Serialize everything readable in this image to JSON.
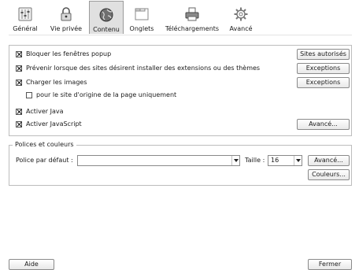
{
  "toolbar": {
    "items": [
      {
        "label": "Général",
        "icon": "general-settings-icon"
      },
      {
        "label": "Vie privée",
        "icon": "lock-icon"
      },
      {
        "label": "Contenu",
        "icon": "globe-icon"
      },
      {
        "label": "Onglets",
        "icon": "tabs-window-icon"
      },
      {
        "label": "Téléchargements",
        "icon": "printer-download-icon"
      },
      {
        "label": "Avancé",
        "icon": "gear-icon"
      }
    ],
    "selected": "Contenu"
  },
  "content": {
    "options": [
      {
        "label": "Bloquer les fenêtres popup",
        "checked": true
      },
      {
        "label": "Prévenir lorsque des sites désirent installer des extensions ou des thèmes",
        "checked": true
      },
      {
        "label": "Charger les images",
        "checked": true
      },
      {
        "label": "pour le site d'origine de la page uniquement",
        "checked": false
      },
      {
        "label": "Activer Java",
        "checked": true
      },
      {
        "label": "Activer JavaScript",
        "checked": true
      }
    ],
    "buttons": {
      "sites_autorises": "Sites autorisés",
      "exceptions_1": "Exceptions",
      "exceptions_2": "Exceptions",
      "avance_js": "Avancé..."
    }
  },
  "fonts": {
    "legend": "Polices et couleurs",
    "default_font_label": "Police par défaut :",
    "default_font_value": "",
    "size_label": "Taille :",
    "size_value": "16",
    "advanced_button": "Avancé...",
    "colors_button": "Couleurs..."
  },
  "footer": {
    "help_button": "Aide",
    "close_button": "Fermer"
  }
}
